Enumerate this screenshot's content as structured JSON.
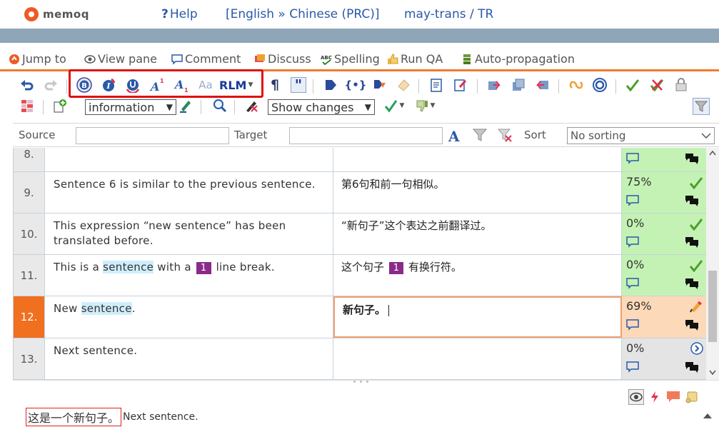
{
  "header": {
    "logo_text": "memoq",
    "help_label": "Help",
    "language_pair": "[English » Chinese (PRC)]",
    "project": "may-trans / TR"
  },
  "commands": [
    {
      "name": "jump-to",
      "label": "Jump to",
      "icon": "jump-icon"
    },
    {
      "name": "view-pane",
      "label": "View pane",
      "icon": "eye-icon"
    },
    {
      "name": "comment",
      "label": "Comment",
      "icon": "comment-icon"
    },
    {
      "name": "discuss",
      "label": "Discuss",
      "icon": "discuss-icon"
    },
    {
      "name": "spelling",
      "label": "Spelling",
      "icon": "spelling-icon"
    },
    {
      "name": "run-qa",
      "label": "Run QA",
      "icon": "thumbs-up-icon"
    },
    {
      "name": "auto-propagation",
      "label": "Auto-propagation",
      "icon": "propagation-icon"
    }
  ],
  "toolbar": {
    "format_a_label": "A",
    "format_a_sub_label": "A",
    "format_aa_label": "Aa",
    "rlm_label": "RLM",
    "paragraph_label": "¶",
    "quote_label": "\"",
    "information_select": "information",
    "show_changes_select": "Show changes"
  },
  "filter": {
    "source_label": "Source",
    "target_label": "Target",
    "sort_label": "Sort",
    "sort_value": "No sorting"
  },
  "rows": [
    {
      "num": "8.",
      "source": "",
      "target": "",
      "pct": ""
    },
    {
      "num": "9.",
      "source": "Sentence 6 is similar to the previous sentence.",
      "target": "第6句和前一句相似。",
      "pct": "75%"
    },
    {
      "num": "10.",
      "source": "This expression “new sentence” has been translated before.",
      "target": "“新句子”这个表达之前翻译过。",
      "pct": "0%"
    },
    {
      "num": "11.",
      "source_a": "This is a ",
      "source_hl": "sentence",
      "source_b": " with a ",
      "source_tag": "1",
      "source_c": " line break.",
      "target_a": "这个句子 ",
      "target_tag": "1",
      "target_b": " 有换行符。",
      "pct": "0%"
    },
    {
      "num": "12.",
      "source_a": "New ",
      "source_hl": "sentence",
      "source_b": ".",
      "target": "新句子。",
      "pct": "69%"
    },
    {
      "num": "13.",
      "source": "Next sentence.",
      "target": "",
      "pct": "0%"
    }
  ],
  "preview": {
    "highlighted": "这是一个新句子。",
    "rest": "Next sentence."
  },
  "colors": {
    "accent": "#f07020",
    "confirmed": "#c4f2b4",
    "editing": "#fcd9b8",
    "empty": "#e4e4e4",
    "tag": "#8a2a8a",
    "link": "#2a5aa8"
  }
}
